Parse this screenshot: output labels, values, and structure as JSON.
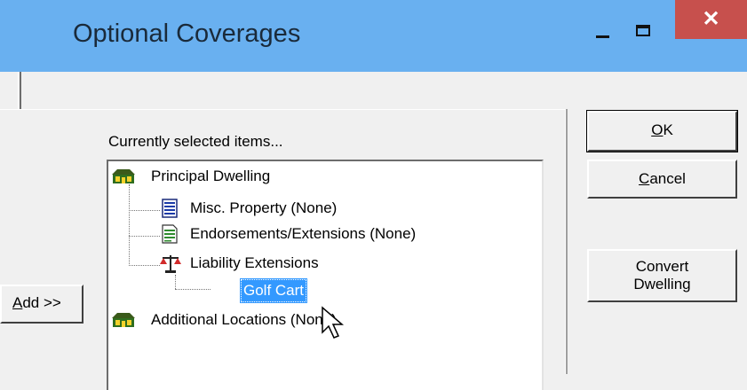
{
  "window": {
    "title": "Optional Coverages",
    "close_glyph": "✕"
  },
  "panel": {
    "currently_selected_label": "Currently selected items..."
  },
  "tree": {
    "principal_dwelling": "Principal Dwelling",
    "misc_property": "Misc. Property (None)",
    "endorsements": "Endorsements/Extensions (None)",
    "liability_extensions": "Liability Extensions",
    "golf_cart": "Golf Cart",
    "additional_locations": "Additional Locations (None)"
  },
  "buttons": {
    "ok": "OK",
    "cancel": "Cancel",
    "convert_line1": "Convert",
    "convert_line2": "Dwelling",
    "add": "Add >>"
  },
  "icons": {
    "house": "house-icon",
    "document": "document-icon",
    "form": "form-icon",
    "scale": "scales-icon",
    "cursor": "arrow-cursor-icon"
  },
  "colors": {
    "titlebar": "#69b0f0",
    "close": "#c7504d",
    "selection": "#3399ff"
  }
}
